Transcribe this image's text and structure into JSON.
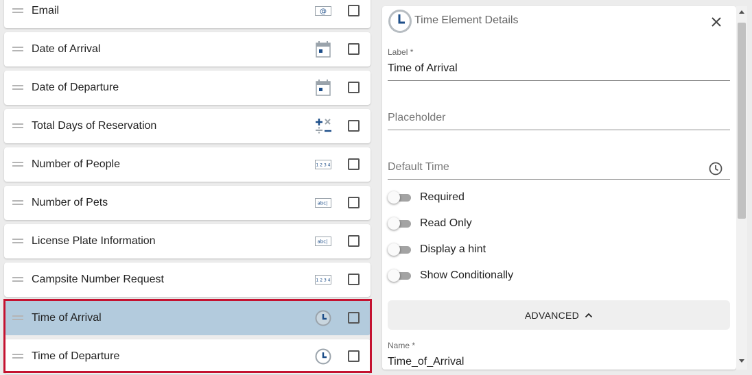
{
  "list": {
    "items": [
      {
        "label": "Email",
        "icon": "email-icon"
      },
      {
        "label": "Date of Arrival",
        "icon": "calendar-icon"
      },
      {
        "label": "Date of Departure",
        "icon": "calendar-icon"
      },
      {
        "label": "Total Days of Reservation",
        "icon": "calculation-icon"
      },
      {
        "label": "Number of People",
        "icon": "number-input-icon"
      },
      {
        "label": "Number of Pets",
        "icon": "text-input-icon"
      },
      {
        "label": "License Plate Information",
        "icon": "text-input-icon"
      },
      {
        "label": "Campsite Number Request",
        "icon": "number-input-icon"
      },
      {
        "label": "Time of Arrival",
        "icon": "clock-icon",
        "selected": true
      },
      {
        "label": "Time of Departure",
        "icon": "clock-icon"
      }
    ],
    "icon_text": {
      "email": "@",
      "number": "1 2 3 4",
      "text": "abc|"
    }
  },
  "panel": {
    "title": "Time Element Details",
    "label_field": {
      "label": "Label *",
      "value": "Time of Arrival"
    },
    "placeholder_field": {
      "placeholder": "Placeholder"
    },
    "default_time_field": {
      "placeholder": "Default Time"
    },
    "toggles": [
      {
        "label": "Required",
        "on": false
      },
      {
        "label": "Read Only",
        "on": false
      },
      {
        "label": "Display a hint",
        "on": false
      },
      {
        "label": "Show Conditionally",
        "on": false
      }
    ],
    "advanced_label": "ADVANCED",
    "name_field": {
      "label": "Name *",
      "value": "Time_of_Arrival"
    }
  },
  "colors": {
    "accent": "#1d4e89",
    "selected_row": "#b3cbdd",
    "highlight_border": "#c41230"
  }
}
